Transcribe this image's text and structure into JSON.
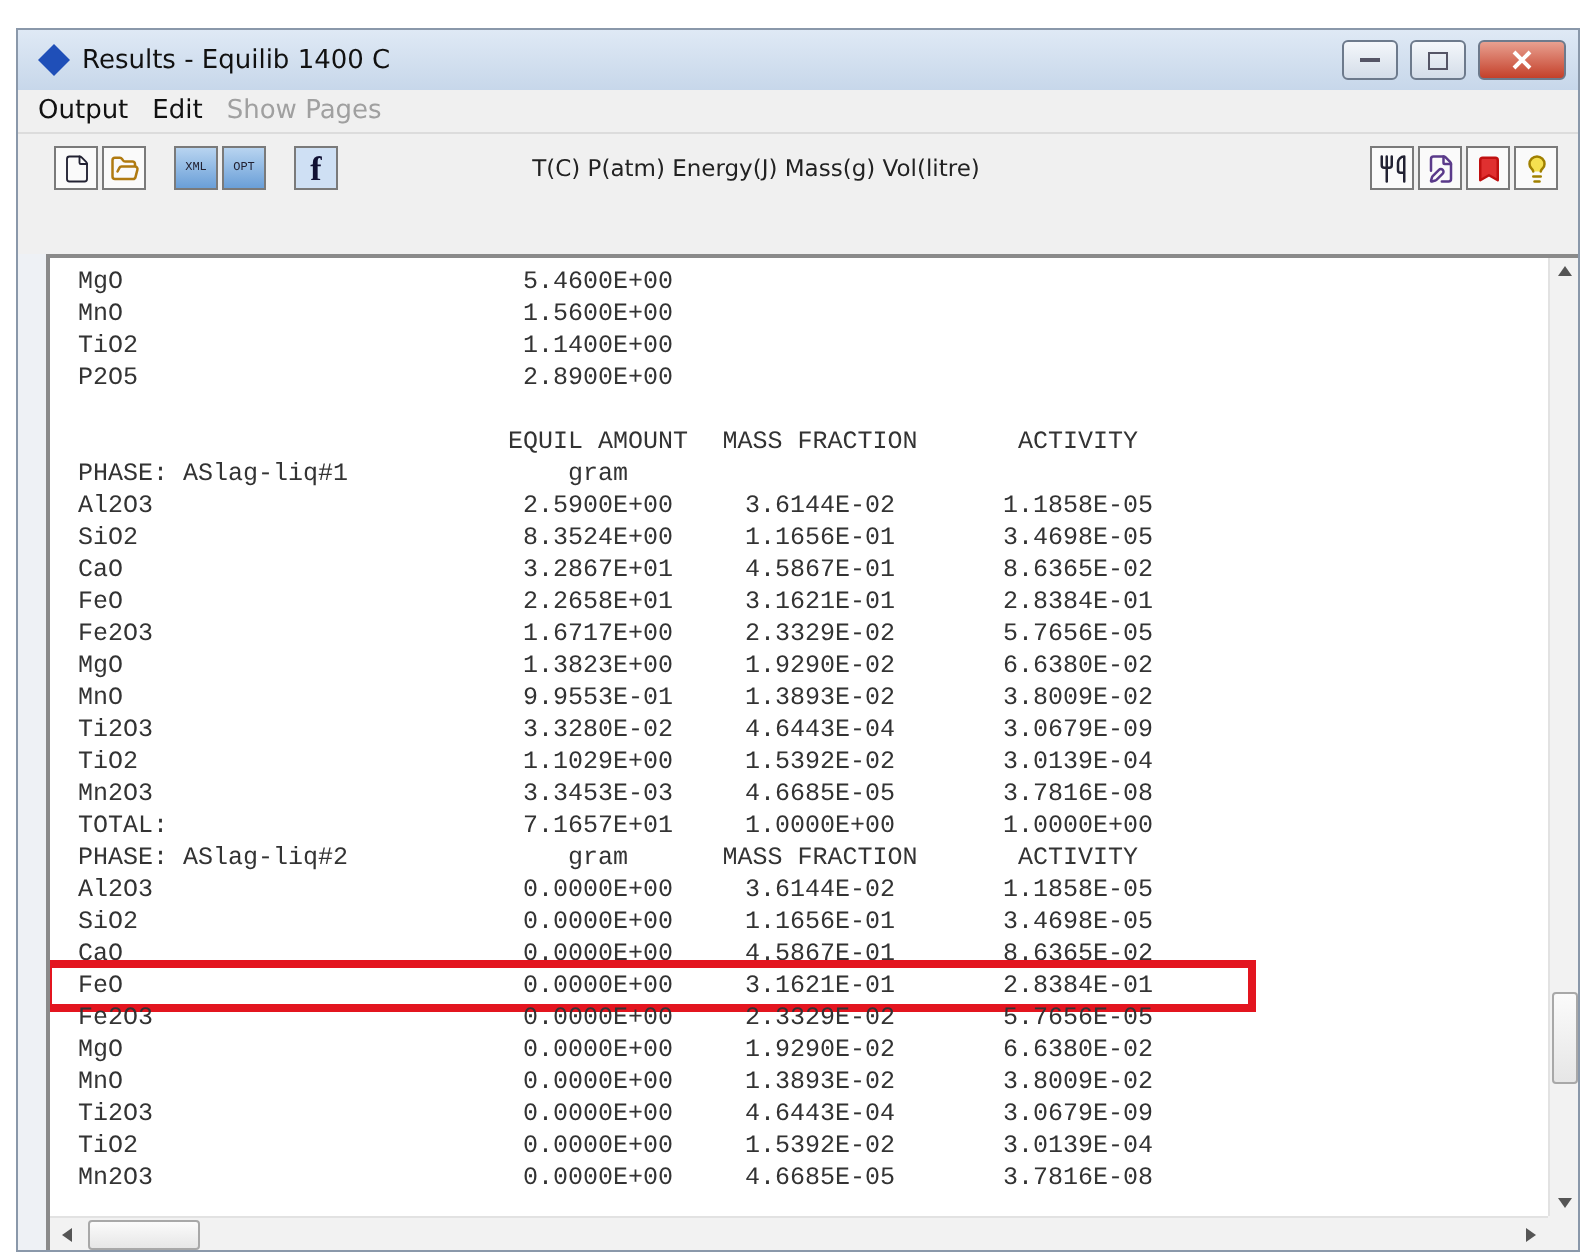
{
  "window": {
    "title": "Results - Equilib  1400 C"
  },
  "menu": [
    {
      "label": "Output",
      "disabled": false
    },
    {
      "label": "Edit",
      "disabled": false
    },
    {
      "label": "Show Pages",
      "disabled": true
    }
  ],
  "toolbar": {
    "xml_label": "XML",
    "opt_label": "OPT",
    "function_label": "f",
    "units": "T(C) P(atm) Energy(J) Mass(g) Vol(litre)"
  },
  "rows": [
    {
      "kind": "data",
      "name": "MgO",
      "amount": "5.4600E+00",
      "highlighted": false
    },
    {
      "kind": "data",
      "name": "MnO",
      "amount": "1.5600E+00",
      "highlighted": false
    },
    {
      "kind": "data",
      "name": "TiO2",
      "amount": "1.1400E+00",
      "highlighted": false
    },
    {
      "kind": "data",
      "name": "P2O5",
      "amount": "2.8900E+00",
      "highlighted": false
    },
    {
      "kind": "blank",
      "highlighted": false
    },
    {
      "kind": "header",
      "amount": "EQUIL AMOUNT",
      "mass_fraction": "MASS FRACTION",
      "activity": "ACTIVITY",
      "highlighted": false
    },
    {
      "kind": "header",
      "name": "PHASE: ASlag-liq#1",
      "amount": "gram",
      "highlighted": false
    },
    {
      "kind": "data",
      "name": "Al2O3",
      "amount": "2.5900E+00",
      "mass_fraction": "3.6144E-02",
      "activity": "1.1858E-05",
      "highlighted": false
    },
    {
      "kind": "data",
      "name": "SiO2",
      "amount": "8.3524E+00",
      "mass_fraction": "1.1656E-01",
      "activity": "3.4698E-05",
      "highlighted": false
    },
    {
      "kind": "data",
      "name": "CaO",
      "amount": "3.2867E+01",
      "mass_fraction": "4.5867E-01",
      "activity": "8.6365E-02",
      "highlighted": false
    },
    {
      "kind": "data",
      "name": "FeO",
      "amount": "2.2658E+01",
      "mass_fraction": "3.1621E-01",
      "activity": "2.8384E-01",
      "highlighted": false
    },
    {
      "kind": "data",
      "name": "Fe2O3",
      "amount": "1.6717E+00",
      "mass_fraction": "2.3329E-02",
      "activity": "5.7656E-05",
      "highlighted": false
    },
    {
      "kind": "data",
      "name": "MgO",
      "amount": "1.3823E+00",
      "mass_fraction": "1.9290E-02",
      "activity": "6.6380E-02",
      "highlighted": false
    },
    {
      "kind": "data",
      "name": "MnO",
      "amount": "9.9553E-01",
      "mass_fraction": "1.3893E-02",
      "activity": "3.8009E-02",
      "highlighted": false
    },
    {
      "kind": "data",
      "name": "Ti2O3",
      "amount": "3.3280E-02",
      "mass_fraction": "4.6443E-04",
      "activity": "3.0679E-09",
      "highlighted": false
    },
    {
      "kind": "data",
      "name": "TiO2",
      "amount": "1.1029E+00",
      "mass_fraction": "1.5392E-02",
      "activity": "3.0139E-04",
      "highlighted": false
    },
    {
      "kind": "data",
      "name": "Mn2O3",
      "amount": "3.3453E-03",
      "mass_fraction": "4.6685E-05",
      "activity": "3.7816E-08",
      "highlighted": false
    },
    {
      "kind": "data",
      "name": "TOTAL:",
      "amount": "7.1657E+01",
      "mass_fraction": "1.0000E+00",
      "activity": "1.0000E+00",
      "highlighted": false
    },
    {
      "kind": "header",
      "name": "PHASE: ASlag-liq#2",
      "amount": "gram",
      "mass_fraction": "MASS FRACTION",
      "activity": "ACTIVITY",
      "highlighted": false
    },
    {
      "kind": "data",
      "name": "Al2O3",
      "amount": "0.0000E+00",
      "mass_fraction": "3.6144E-02",
      "activity": "1.1858E-05",
      "highlighted": false
    },
    {
      "kind": "data",
      "name": "SiO2",
      "amount": "0.0000E+00",
      "mass_fraction": "1.1656E-01",
      "activity": "3.4698E-05",
      "highlighted": false
    },
    {
      "kind": "data",
      "name": "CaO",
      "amount": "0.0000E+00",
      "mass_fraction": "4.5867E-01",
      "activity": "8.6365E-02",
      "highlighted": false
    },
    {
      "kind": "data",
      "name": "FeO",
      "amount": "0.0000E+00",
      "mass_fraction": "3.1621E-01",
      "activity": "2.8384E-01",
      "highlighted": true
    },
    {
      "kind": "data",
      "name": "Fe2O3",
      "amount": "0.0000E+00",
      "mass_fraction": "2.3329E-02",
      "activity": "5.7656E-05",
      "highlighted": false
    },
    {
      "kind": "data",
      "name": "MgO",
      "amount": "0.0000E+00",
      "mass_fraction": "1.9290E-02",
      "activity": "6.6380E-02",
      "highlighted": false
    },
    {
      "kind": "data",
      "name": "MnO",
      "amount": "0.0000E+00",
      "mass_fraction": "1.3893E-02",
      "activity": "3.8009E-02",
      "highlighted": false
    },
    {
      "kind": "data",
      "name": "Ti2O3",
      "amount": "0.0000E+00",
      "mass_fraction": "4.6443E-04",
      "activity": "3.0679E-09",
      "highlighted": false
    },
    {
      "kind": "data",
      "name": "TiO2",
      "amount": "0.0000E+00",
      "mass_fraction": "1.5392E-02",
      "activity": "3.0139E-04",
      "highlighted": false
    },
    {
      "kind": "data",
      "name": "Mn2O3",
      "amount": "0.0000E+00",
      "mass_fraction": "4.6685E-05",
      "activity": "3.7816E-08",
      "highlighted": false
    }
  ]
}
